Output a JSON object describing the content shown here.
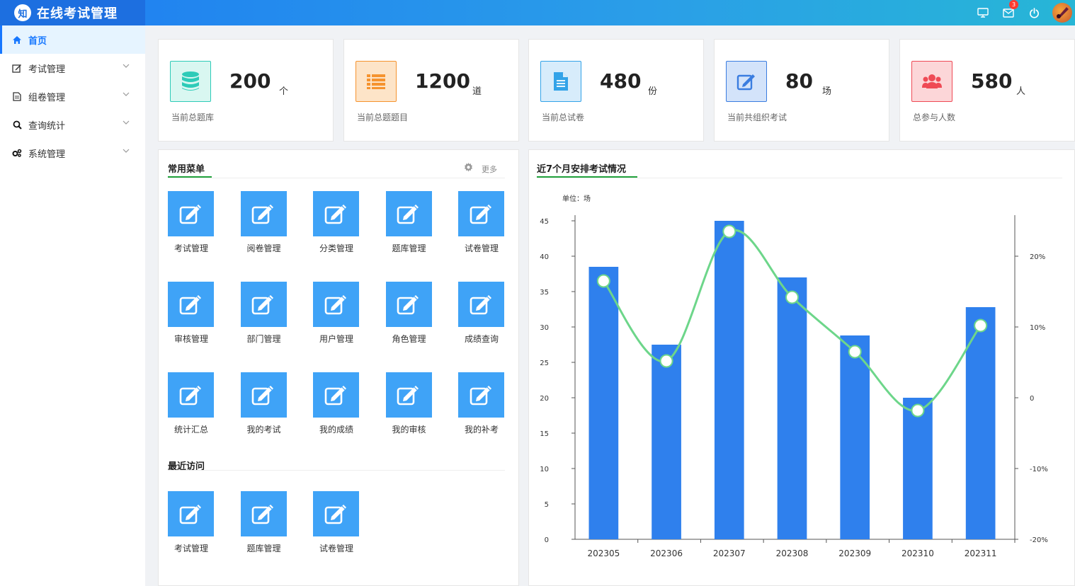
{
  "app": {
    "logo_text": "知",
    "title": "在线考试管理",
    "notification_count": "3"
  },
  "sidebar": {
    "items": [
      {
        "label": "首页",
        "icon": "home-icon",
        "active": true
      },
      {
        "label": "考试管理",
        "icon": "edit-icon"
      },
      {
        "label": "组卷管理",
        "icon": "file-icon"
      },
      {
        "label": "查询统计",
        "icon": "search-icon"
      },
      {
        "label": "系统管理",
        "icon": "cogs-icon"
      }
    ]
  },
  "stats": [
    {
      "value": "200",
      "unit": "个",
      "label": "当前总题库",
      "icon": "database-icon",
      "color": "#2ecbb8",
      "bg": "#d9f7f1"
    },
    {
      "value": "1200",
      "unit": "道",
      "label": "当前总题题目",
      "icon": "list-icon",
      "color": "#f5932f",
      "bg": "#fde4c8"
    },
    {
      "value": "480",
      "unit": "份",
      "label": "当前总试卷",
      "icon": "document-icon",
      "color": "#33a3e8",
      "bg": "#d7ecfb"
    },
    {
      "value": "80",
      "unit": "场",
      "label": "当前共组织考试",
      "icon": "edit-icon",
      "color": "#3a7de0",
      "bg": "#d3e3fa"
    },
    {
      "value": "580",
      "unit": "人",
      "label": "总参与人数",
      "icon": "users-icon",
      "color": "#ef4a55",
      "bg": "#fcd6d8"
    }
  ],
  "common_menu": {
    "title": "常用菜单",
    "more_label": "更多",
    "items": [
      "考试管理",
      "阅卷管理",
      "分类管理",
      "题库管理",
      "试卷管理",
      "审核管理",
      "部门管理",
      "用户管理",
      "角色管理",
      "成绩查询",
      "统计汇总",
      "我的考试",
      "我的成绩",
      "我的审核",
      "我的补考"
    ]
  },
  "recent": {
    "title": "最近访问",
    "items": [
      "考试管理",
      "题库管理",
      "试卷管理"
    ]
  },
  "chart_panel": {
    "title": "近7个月安排考试情况",
    "unit_label": "单位：场"
  },
  "chart_data": {
    "type": "bar",
    "categories": [
      "202305",
      "202306",
      "202307",
      "202308",
      "202309",
      "202310",
      "202311"
    ],
    "series": [
      {
        "type": "bar",
        "axis": "left",
        "values": [
          38.5,
          27.5,
          45,
          37,
          28.8,
          20,
          32.8
        ],
        "color": "#2f80ed"
      },
      {
        "type": "line",
        "axis": "right",
        "smooth": true,
        "values": [
          16.5,
          5.2,
          23.5,
          14.2,
          6.5,
          -1.8,
          10.2
        ],
        "color": "#6dd68a"
      }
    ],
    "y_left": {
      "min": 0,
      "max": 45,
      "ticks": [
        0,
        5,
        10,
        15,
        20,
        25,
        30,
        35,
        40,
        45
      ]
    },
    "y_right": {
      "min": -20,
      "max": 25,
      "ticks": [
        -20,
        -10,
        0,
        10,
        20
      ],
      "tick_labels": [
        "-20%",
        "-10%",
        "0",
        "10%",
        "20%"
      ]
    },
    "grid": false
  }
}
